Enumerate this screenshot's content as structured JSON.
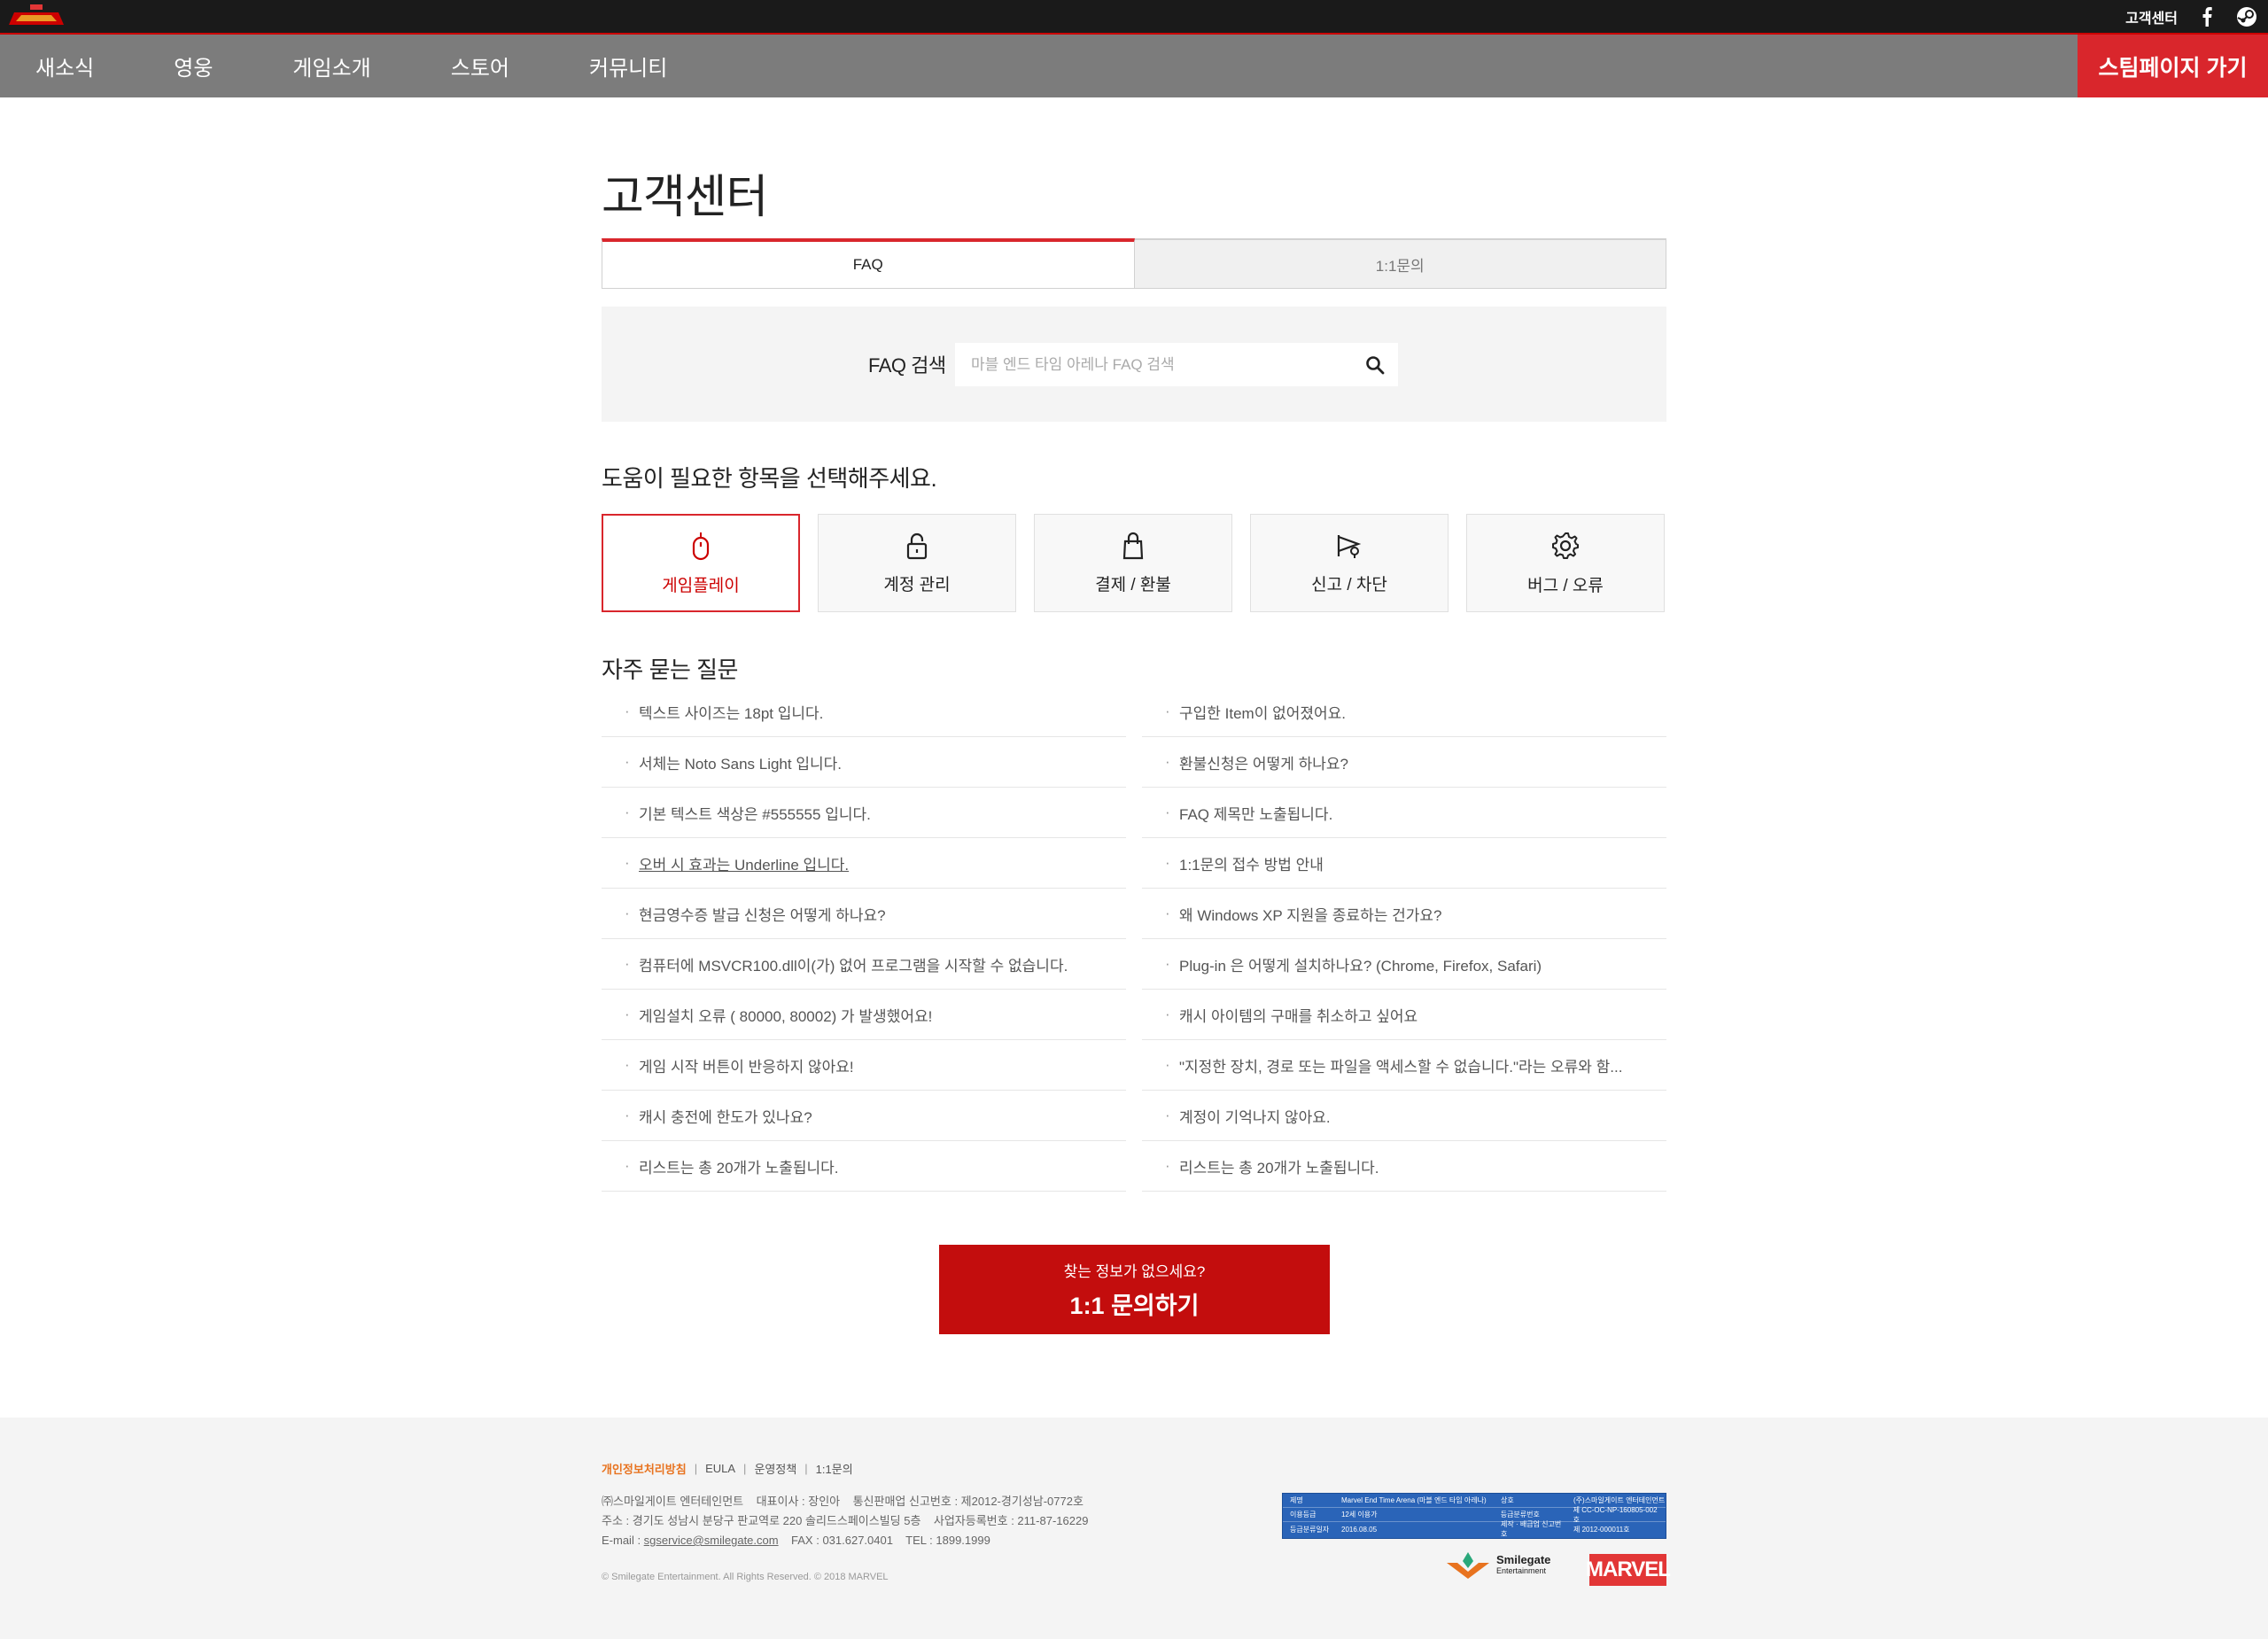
{
  "topbar": {
    "logo_text": "MARVEL ARENA",
    "support_link": "고객센터",
    "facebook_icon": "facebook-icon",
    "steam_icon": "steam-icon"
  },
  "nav": {
    "items": [
      "새소식",
      "영웅",
      "게임소개",
      "스토어",
      "커뮤니티"
    ],
    "steam_button": "스팀페이지 가기"
  },
  "page": {
    "title": "고객센터",
    "tabs": [
      {
        "label": "FAQ",
        "active": true
      },
      {
        "label": "1:1문의",
        "active": false
      }
    ]
  },
  "search": {
    "label": "FAQ 검색",
    "placeholder": "마블 엔드 타임 아레나 FAQ 검색",
    "value": ""
  },
  "help": {
    "title": "도움이 필요한 항목을 선택해주세요.",
    "categories": [
      {
        "label": "게임플레이",
        "icon": "mouse-icon",
        "active": true
      },
      {
        "label": "계정 관리",
        "icon": "lock-icon",
        "active": false
      },
      {
        "label": "결제 / 환불",
        "icon": "shopping-bag-icon",
        "active": false
      },
      {
        "label": "신고 / 차단",
        "icon": "megaphone-icon",
        "active": false
      },
      {
        "label": "버그 / 오류",
        "icon": "gear-icon",
        "active": false
      }
    ]
  },
  "faq": {
    "title": "자주 묻는 질문",
    "left": [
      "텍스트 사이즈는 18pt 입니다.",
      "서체는 Noto Sans Light 입니다.",
      "기본 텍스트 색상은 #555555 입니다.",
      "오버 시 효과는 Underline 입니다.",
      "현금영수증 발급 신청은 어떻게 하나요?",
      "컴퓨터에 MSVCR100.dll이(가) 없어 프로그램을 시작할 수 없습니다.",
      "게임설치 오류 ( 80000, 80002) 가 발생했어요!",
      "게임 시작 버튼이 반응하지 않아요!",
      "캐시 충전에 한도가 있나요?",
      "리스트는 총 20개가 노출됩니다."
    ],
    "right": [
      "구입한 Item이 없어졌어요.",
      "환불신청은 어떻게 하나요?",
      "FAQ 제목만 노출됩니다.",
      "1:1문의 접수 방법 안내",
      "왜 Windows XP 지원을 종료하는 건가요?",
      "Plug-in 은 어떻게 설치하나요? (Chrome, Firefox, Safari)",
      "캐시 아이템의 구매를 취소하고 싶어요",
      "\"지정한 장치, 경로 또는 파일을 액세스할 수 없습니다.\"라는 오류와 함...",
      "계정이 기억나지 않아요.",
      "리스트는 총 20개가 노출됩니다."
    ]
  },
  "contact": {
    "sub": "찾는 정보가 없으세요?",
    "main": "1:1 문의하기"
  },
  "footer": {
    "links": [
      "개인정보처리방침",
      "EULA",
      "운영정책",
      "1:1문의"
    ],
    "line1": "㈜스마일게이트 엔터테인먼트    대표이사 : 장인아    통신판매업 신고번호 : 제2012-경기성남-0772호",
    "line2": "주소 : 경기도 성남시 분당구 판교역로 220 솔리드스페이스빌딩 5층    사업자등록번호 : 211-87-16229",
    "email_label": "E-mail : ",
    "email": "sgservice@smilegate.com",
    "line3_rest": "    FAX : 031.627.0401    TEL : 1899.1999",
    "copyright": "© Smilegate Entertainment. All Rights Reserved. © 2018 MARVEL",
    "grade_rows": [
      [
        "제명",
        "Marvel End Time Arena (마블 엔드 타임 아레나)",
        "상호",
        "(주)스마일게이트 엔터테인먼트"
      ],
      [
        "이용등급",
        "12세 이용가",
        "등급분류번호",
        "제 CC-OC-NP-160805-002 호"
      ],
      [
        "등급분류일자",
        "2016.08.05",
        "제작 · 배급업 신고번호",
        "제 2012-000011호"
      ]
    ],
    "smilegate_name": "Smilegate",
    "smilegate_sub": "Entertainment",
    "marvel_logo": "MARVEL"
  }
}
